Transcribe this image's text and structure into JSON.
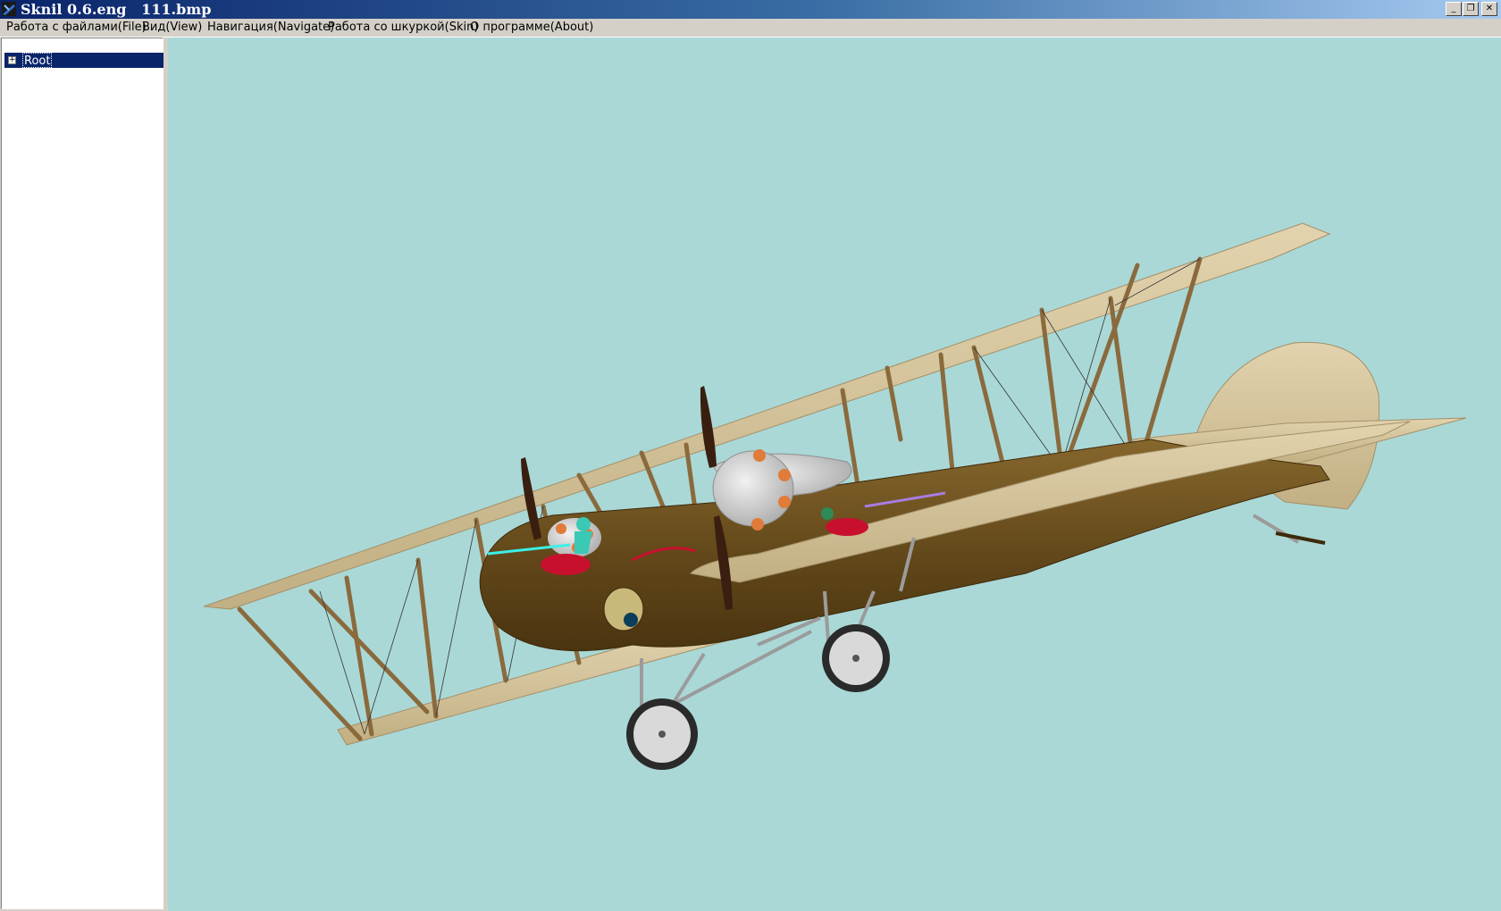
{
  "window": {
    "title": "Sknil 0.6.eng   111.bmp",
    "icon": "app-icon",
    "buttons": {
      "minimize": "_",
      "restore": "❐",
      "close": "✕"
    }
  },
  "menu": {
    "items": [
      {
        "label": "Работа с файлами(File)"
      },
      {
        "label": "Вид(View)"
      },
      {
        "label": "Навигация(Navigate)"
      },
      {
        "label": "Работа со шкуркой(Skin)"
      },
      {
        "label": "О программе(About)"
      }
    ]
  },
  "tree": {
    "root": {
      "label": "Root",
      "expander": "+"
    }
  },
  "viewport": {
    "background": "#aad8d7",
    "content": "biplane-3d-model"
  },
  "colors": {
    "wood_wing": "#d2c198",
    "fuselage": "#6e5321",
    "strut": "#8a6a3c"
  }
}
